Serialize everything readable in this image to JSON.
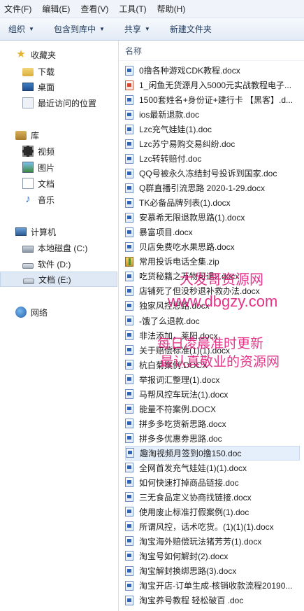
{
  "menubar": {
    "items": [
      "文件(F)",
      "编辑(E)",
      "查看(V)",
      "工具(T)",
      "帮助(H)"
    ]
  },
  "toolbar": {
    "organize": "组织",
    "include_in_library": "包含到库中",
    "share": "共享",
    "new_folder": "新建文件夹"
  },
  "nav": {
    "favorites": "收藏夹",
    "downloads": "下载",
    "desktop": "桌面",
    "recent": "最近访问的位置",
    "libraries": "库",
    "videos": "视频",
    "pictures": "图片",
    "documents": "文档",
    "music": "音乐",
    "computer": "计算机",
    "local_disk_c": "本地磁盘 (C:)",
    "software_d": "软件 (D:)",
    "documents_e": "文档 (E:)",
    "network": "网络"
  },
  "list": {
    "column_name": "名称",
    "files": [
      {
        "name": "0撸各种游戏CDK教程.docx",
        "type": "doc"
      },
      {
        "name": "1_闲鱼无货源月入5000元实战教程电子...",
        "type": "pdf"
      },
      {
        "name": "1500套姓名+身份证+建行卡 【黑客】.d...",
        "type": "doc"
      },
      {
        "name": "ios最新退款.doc",
        "type": "doc"
      },
      {
        "name": "Lzc充气娃娃(1).doc",
        "type": "doc"
      },
      {
        "name": "Lzc苏宁易购交易纠纷.doc",
        "type": "doc"
      },
      {
        "name": "Lzc转转赔付.doc",
        "type": "doc"
      },
      {
        "name": "QQ号被永久冻结封号投诉到国家.doc",
        "type": "doc"
      },
      {
        "name": "Q群直播引流思路  2020-1-29.docx",
        "type": "doc"
      },
      {
        "name": "TK必备品牌列表(1).docx",
        "type": "doc"
      },
      {
        "name": "安慕希无限退款思路(1).docx",
        "type": "doc"
      },
      {
        "name": "暴富项目.docx",
        "type": "doc"
      },
      {
        "name": "贝店免费吃水果思路.docx",
        "type": "doc"
      },
      {
        "name": "常用投诉电话全集.zip",
        "type": "zip"
      },
      {
        "name": "吃货秘籍之万物可退2.docx",
        "type": "doc"
      },
      {
        "name": "店铺死了但没秒退补救办法.docx",
        "type": "doc"
      },
      {
        "name": "独家风控思路.docx",
        "type": "doc"
      },
      {
        "name": "-饿了么退款.doc",
        "type": "doc"
      },
      {
        "name": "非法添加，莱阳.docx",
        "type": "doc"
      },
      {
        "name": "关于赔偿标准(1)(1).docx",
        "type": "doc"
      },
      {
        "name": "杭白菊案例.DOCX",
        "type": "doc"
      },
      {
        "name": "举报词汇整理(1).docx",
        "type": "doc"
      },
      {
        "name": "马帮风控车玩法(1).docx",
        "type": "doc"
      },
      {
        "name": "能量不符案例.DOCX",
        "type": "doc"
      },
      {
        "name": "拼多多吃货新思路.docx",
        "type": "doc"
      },
      {
        "name": "拼多多优惠券思路.doc",
        "type": "doc"
      },
      {
        "name": "趣淘视频月签到0撸150.doc",
        "type": "doc"
      },
      {
        "name": "全网首发充气娃娃(1)(1).docx",
        "type": "doc"
      },
      {
        "name": "如何快速打掉商品链接.doc",
        "type": "doc"
      },
      {
        "name": "三无食品定义协商找链接.docx",
        "type": "doc"
      },
      {
        "name": "使用废止标准打假案例(1).doc",
        "type": "doc"
      },
      {
        "name": "所谓风控，话术吃货。(1)(1)(1).docx",
        "type": "doc"
      },
      {
        "name": "淘宝海外赔偿玩法猪芳芳(1).docx",
        "type": "doc"
      },
      {
        "name": "淘宝号如何解封(2).docx",
        "type": "doc"
      },
      {
        "name": "淘宝解封换绑思路(3).docx",
        "type": "doc"
      },
      {
        "name": "淘宝开店-订单生成-核销收款流程20190...",
        "type": "doc"
      },
      {
        "name": "淘宝养号教程 轻松破百 .doc",
        "type": "doc"
      }
    ]
  },
  "watermark": {
    "line1": "大发哥资源网",
    "line2": "www.dbgzy.com",
    "line3": "每日凌晨准时更新",
    "line4": "最认真敬业的资源网"
  }
}
